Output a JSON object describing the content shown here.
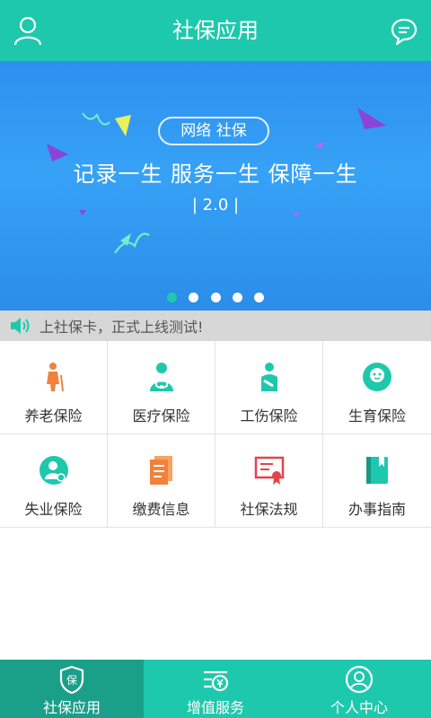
{
  "header": {
    "title": "社保应用",
    "left_icon": "user-icon",
    "right_icon": "chat-bubble-icon"
  },
  "banner": {
    "pill": "网络 社保",
    "slogan": "记录一生 服务一生 保障一生",
    "version": "| 2.0 |",
    "slide_count": 5,
    "active_slide": 1
  },
  "notice": {
    "text": "上社保卡，正式上线测试!",
    "icon": "speaker-icon"
  },
  "services": [
    {
      "label": "养老保险",
      "icon": "elderly-icon",
      "color": "#f0823c"
    },
    {
      "label": "医疗保险",
      "icon": "doctor-icon",
      "color": "#1ec8ad"
    },
    {
      "label": "工伤保险",
      "icon": "injured-person-icon",
      "color": "#1ec8ad"
    },
    {
      "label": "生育保险",
      "icon": "baby-icon",
      "color": "#1ec8ad"
    },
    {
      "label": "失业保险",
      "icon": "unemployed-person-icon",
      "color": "#1ec8ad"
    },
    {
      "label": "缴费信息",
      "icon": "document-icon",
      "color": "#f0823c"
    },
    {
      "label": "社保法规",
      "icon": "certificate-icon",
      "color": "#e0454a"
    },
    {
      "label": "办事指南",
      "icon": "guide-book-icon",
      "color": "#1ec8ad"
    }
  ],
  "tabs": [
    {
      "label": "社保应用",
      "icon": "shield-icon",
      "badge": "保",
      "active": true
    },
    {
      "label": "增值服务",
      "icon": "yuan-list-icon",
      "active": false
    },
    {
      "label": "个人中心",
      "icon": "profile-icon",
      "active": false
    }
  ],
  "colors": {
    "primary": "#1ec8ad",
    "primary_dark": "#1a9f8a",
    "banner_blue": "#2e8ff0",
    "notice_bg": "#d7d7d7"
  }
}
